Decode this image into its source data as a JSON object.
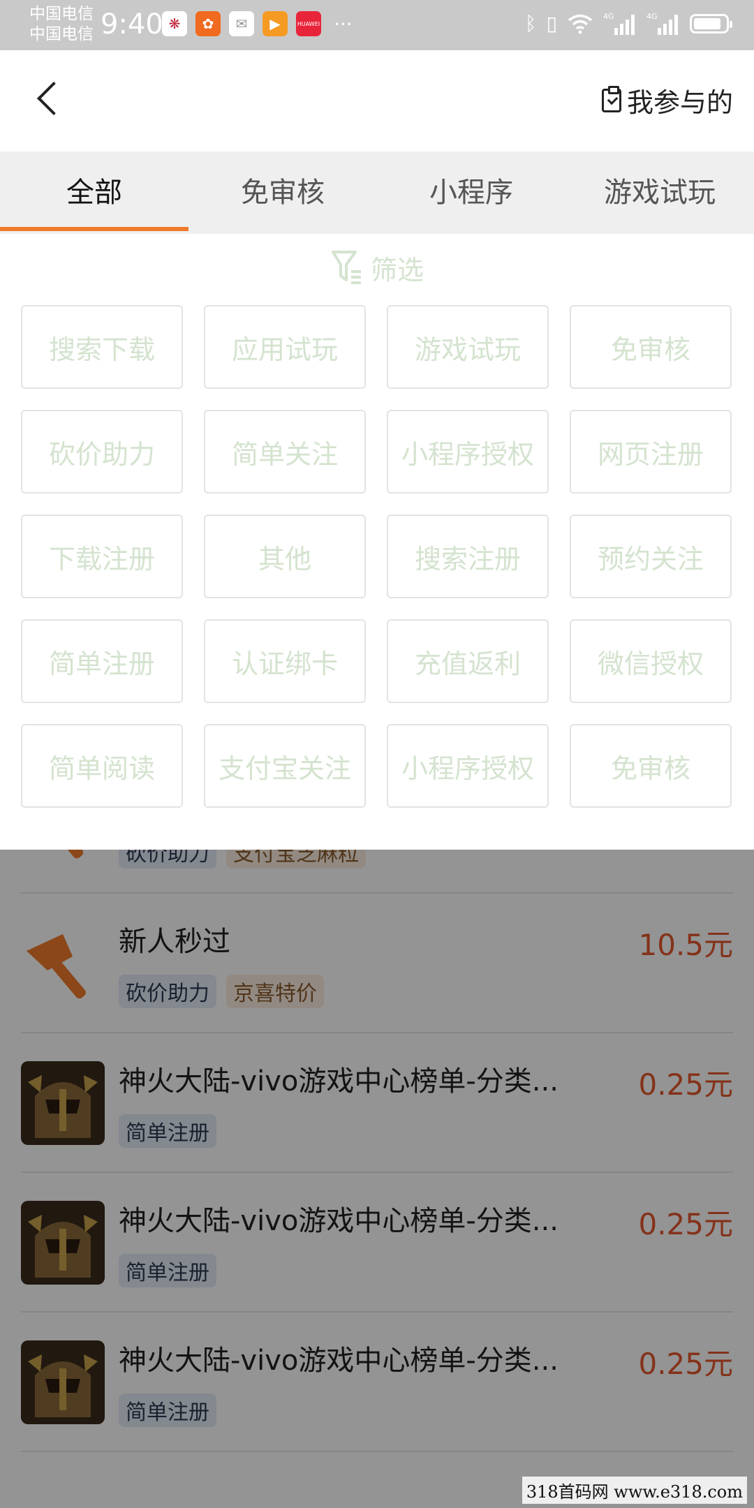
{
  "status_bar": {
    "carrier1": "中国电信",
    "carrier2": "中国电信",
    "time": "9:40",
    "more": "···",
    "icons": [
      "red-snowflake-app-icon",
      "orange-app-icon",
      "mail-app-icon",
      "video-app-icon",
      "huawei-app-icon",
      "bluetooth-icon",
      "vibrate-icon",
      "wifi-icon",
      "signal-4g-icon",
      "signal-4g-icon",
      "battery-icon"
    ],
    "signal1_label": "4G",
    "signal2_label": "4G",
    "huawei_label": "HUAWEI"
  },
  "header": {
    "back_icon": "chevron-left-icon",
    "mine_icon": "clipboard-check-icon",
    "mine_label": "我参与的"
  },
  "tabs": [
    {
      "label": "全部",
      "active": true
    },
    {
      "label": "免审核",
      "active": false
    },
    {
      "label": "小程序",
      "active": false
    },
    {
      "label": "游戏试玩",
      "active": false
    }
  ],
  "filter": {
    "icon": "filter-funnel-icon",
    "label": "筛选",
    "chips": [
      "搜索下载",
      "应用试玩",
      "游戏试玩",
      "免审核",
      "砍价助力",
      "简单关注",
      "小程序授权",
      "网页注册",
      "下载注册",
      "其他",
      "搜索注册",
      "预约关注",
      "简单注册",
      "认证绑卡",
      "充值返利",
      "微信授权",
      "简单阅读",
      "支付宝关注",
      "小程序授权",
      "免审核"
    ]
  },
  "tasks": [
    {
      "title": "",
      "price": "",
      "icon": "axe-icon",
      "tags": [
        {
          "text": "砍价助力",
          "style": "blue"
        },
        {
          "text": "支付宝芝麻粒",
          "style": "orange"
        }
      ]
    },
    {
      "title": "新人秒过",
      "price": "10.5元",
      "icon": "axe-icon",
      "tags": [
        {
          "text": "砍价助力",
          "style": "blue"
        },
        {
          "text": "京喜特价",
          "style": "orange"
        }
      ]
    },
    {
      "title": "神火大陆-vivo游戏中心榜单-分类...",
      "price": "0.25元",
      "icon": "game-knight-icon",
      "tags": [
        {
          "text": "简单注册",
          "style": "blue"
        }
      ]
    },
    {
      "title": "神火大陆-vivo游戏中心榜单-分类...",
      "price": "0.25元",
      "icon": "game-knight-icon",
      "tags": [
        {
          "text": "简单注册",
          "style": "blue"
        }
      ]
    },
    {
      "title": "神火大陆-vivo游戏中心榜单-分类...",
      "price": "0.25元",
      "icon": "game-knight-icon",
      "tags": [
        {
          "text": "简单注册",
          "style": "blue"
        }
      ]
    }
  ],
  "watermark": "318首码网  www.e318.com",
  "colors": {
    "accent": "#f07a2b",
    "price": "#e4572e",
    "chip_text": "#d4e3cf",
    "tab_bg": "#efefef"
  }
}
